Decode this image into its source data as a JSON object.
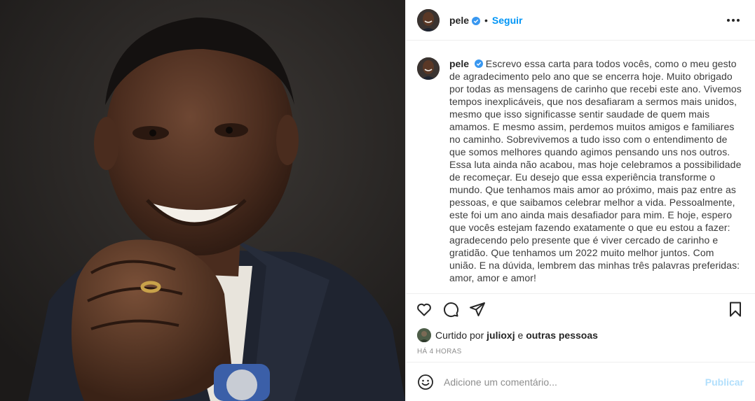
{
  "header": {
    "username": "pele",
    "separator": "•",
    "follow_label": "Seguir",
    "verified_icon": "verified-badge-icon",
    "more_icon": "more-options-icon"
  },
  "caption": {
    "username": "pele",
    "text": "Escrevo essa carta para todos vocês, como o meu gesto de agradecimento pelo ano que se encerra hoje. Muito obrigado por todas as mensagens de carinho que recebi este ano. Vivemos tempos inexplicáveis, que nos desafiaram a sermos mais unidos, mesmo que isso significasse sentir saudade de quem mais amamos. E mesmo assim, perdemos muitos amigos e familiares no caminho. Sobrevivemos a tudo isso com o entendimento de que somos melhores quando agimos pensando uns nos outros. Essa luta ainda não acabou, mas hoje celebramos a possibilidade de recomeçar. Eu desejo que essa experiência transforme o mundo. Que tenhamos mais amor ao próximo, mais paz entre as pessoas, e que saibamos celebrar melhor a vida. Pessoalmente, este foi um ano ainda mais desafiador para mim. E hoje, espero que vocês estejam fazendo exatamente o que eu estou a fazer: agradecendo pelo presente que é viver cercado de carinho e gratidão. Que tenhamos um 2022 muito melhor juntos. Com união. E na dúvida, lembrem das minhas três palavras preferidas: amor, amor e amor!"
  },
  "actions": {
    "like_icon": "heart-icon",
    "comment_icon": "comment-icon",
    "share_icon": "share-icon",
    "save_icon": "bookmark-icon"
  },
  "likes": {
    "prefix": "Curtido por",
    "user": "julioxj",
    "connector": "e",
    "others": "outras pessoas"
  },
  "timestamp": "HÁ 4 HORAS",
  "comment_box": {
    "emoji_icon": "smiley-icon",
    "placeholder": "Adicione um comentário...",
    "publish_label": "Publicar"
  },
  "colors": {
    "accent": "#0095f6",
    "publish_disabled": "#b2dffc",
    "verified": "#3897f0",
    "text": "#262626",
    "muted": "#8e8e8e"
  }
}
